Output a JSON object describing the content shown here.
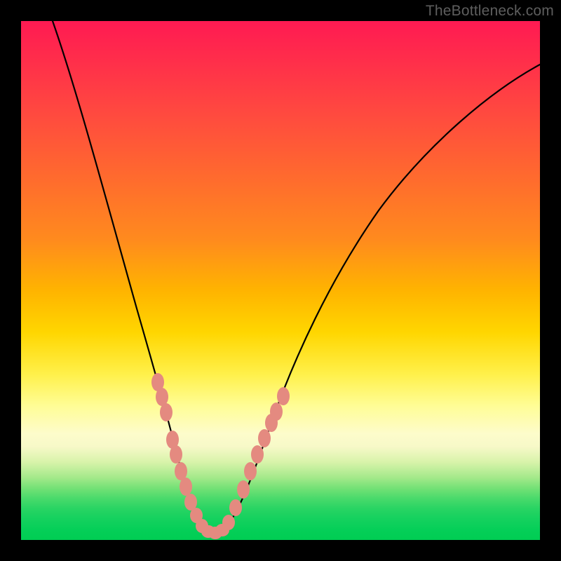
{
  "watermark": "TheBottleneck.com",
  "chart_data": {
    "type": "line",
    "title": "",
    "xlabel": "",
    "ylabel": "",
    "xlim": [
      0,
      100
    ],
    "ylim": [
      0,
      100
    ],
    "series": [
      {
        "name": "bottleneck-curve",
        "x": [
          0,
          4,
          8,
          12,
          16,
          20,
          23,
          26,
          28,
          30,
          31.5,
          33,
          34.5,
          36,
          39,
          43,
          48,
          54,
          62,
          72,
          84,
          96,
          100
        ],
        "y": [
          105,
          92,
          80,
          68,
          56,
          44,
          34,
          24,
          16,
          10,
          6,
          3,
          2,
          2,
          6,
          14,
          24,
          34,
          46,
          58,
          70,
          80,
          84
        ]
      }
    ],
    "markers": {
      "name": "highlight-points",
      "color": "#e48a80",
      "points": [
        {
          "x": 24,
          "y": 30
        },
        {
          "x": 24.8,
          "y": 27
        },
        {
          "x": 25.6,
          "y": 24
        },
        {
          "x": 27.2,
          "y": 18.5
        },
        {
          "x": 28,
          "y": 15.5
        },
        {
          "x": 29,
          "y": 12.5
        },
        {
          "x": 30,
          "y": 9.5
        },
        {
          "x": 31,
          "y": 6
        },
        {
          "x": 32,
          "y": 3.5
        },
        {
          "x": 33,
          "y": 2.2
        },
        {
          "x": 34,
          "y": 1.8
        },
        {
          "x": 35,
          "y": 1.8
        },
        {
          "x": 36,
          "y": 2.2
        },
        {
          "x": 37,
          "y": 3.5
        },
        {
          "x": 38.5,
          "y": 6.5
        },
        {
          "x": 40,
          "y": 10
        },
        {
          "x": 41.5,
          "y": 13.5
        },
        {
          "x": 43,
          "y": 17
        },
        {
          "x": 44.5,
          "y": 20
        },
        {
          "x": 46,
          "y": 23
        },
        {
          "x": 47,
          "y": 25
        },
        {
          "x": 48.5,
          "y": 28
        }
      ]
    },
    "background_gradient": {
      "top": "#ff1a52",
      "mid": "#ffd600",
      "bottom": "#00cd53"
    }
  }
}
